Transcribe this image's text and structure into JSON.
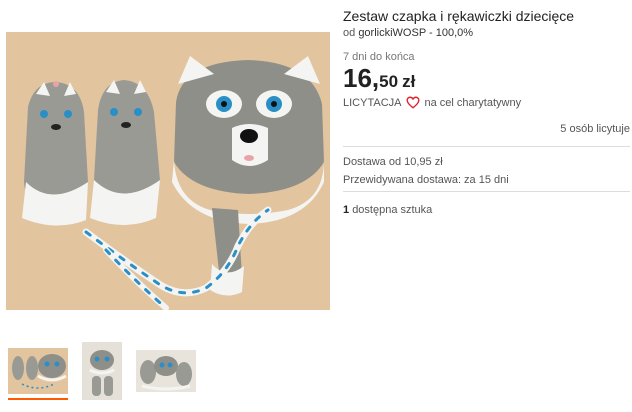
{
  "listing": {
    "title": "Zestaw czapka i rękawiczki dziecięce",
    "seller_prefix": "od",
    "seller_name": "gorlickiWOSP - 100,0%",
    "ends": "7 dni do końca",
    "price_main": "16,",
    "price_cents": "50",
    "currency": "zł",
    "auction_label": "LICYTACJA",
    "charity_text": "na cel charytatywny",
    "bidders": "5 osób licytuje",
    "delivery": "Dostawa od 10,95 zł",
    "eta": "Przewidywana dostawa: za 15 dni",
    "stock_count": "1",
    "stock_text": "dostępna sztuka"
  },
  "gallery": {
    "selected_index": 0,
    "thumbnail_count": 3
  },
  "colors": {
    "accent": "#ff5a00",
    "heart": "#e0242f",
    "photo_bg": "#e2c49f",
    "yarn_blue": "#2a8fc7"
  },
  "icons": [
    "heart-icon"
  ]
}
